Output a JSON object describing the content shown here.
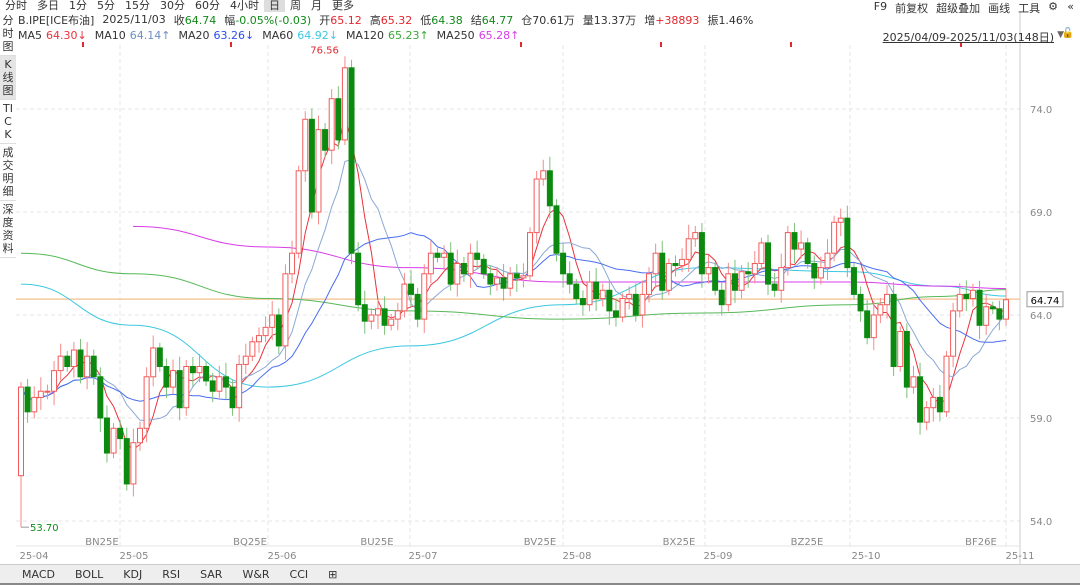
{
  "period_tabs": [
    "分时",
    "多日",
    "1分",
    "5分",
    "15分",
    "30分",
    "60分",
    "4小时",
    "日",
    "周",
    "月",
    "更多"
  ],
  "selected_period": "日",
  "right_tools": [
    "F9",
    "前复权",
    "超级叠加",
    "画线",
    "工具"
  ],
  "left_tabs": [
    "分时图",
    "K线图",
    "TICK",
    "成交明细",
    "深度资料"
  ],
  "info": {
    "symbol": "B.IPE[ICE布油]",
    "date": "2025/11/03",
    "close_label": "收",
    "close": "64.74",
    "change_label": "幅",
    "change": "-0.05%(-0.03)",
    "open_label": "开",
    "open": "65.12",
    "high_label": "高",
    "high": "65.32",
    "low_label": "低",
    "low": "64.38",
    "settle_label": "结",
    "settle": "64.77",
    "oi_label": "仓",
    "oi": "70.61万",
    "vol_label": "量",
    "vol": "13.37万",
    "inc_label": "增",
    "inc": "+38893",
    "amp_label": "振",
    "amp": "1.46%"
  },
  "ma": [
    {
      "name": "MA5",
      "value": "64.30↓",
      "color": "#e8323c"
    },
    {
      "name": "MA10",
      "value": "64.14↑",
      "color": "#6a8fc4"
    },
    {
      "name": "MA20",
      "value": "63.26↓",
      "color": "#2a4df0"
    },
    {
      "name": "MA60",
      "value": "64.92↓",
      "color": "#3cc8e0"
    },
    {
      "name": "MA120",
      "value": "65.23↑",
      "color": "#3aa63a"
    },
    {
      "name": "MA250",
      "value": "65.28↑",
      "color": "#d83ce8"
    }
  ],
  "date_range": "2025/04/09-2025/11/03(148日)",
  "bottom_tabs": [
    "MACD",
    "BOLL",
    "KDJ",
    "RSI",
    "SAR",
    "W&R",
    "CCI",
    "⊞"
  ],
  "chart_data": {
    "type": "candlestick",
    "y_ticks": [
      "74.0",
      "69.0",
      "64.0",
      "59.0",
      "54.0"
    ],
    "ylim": [
      53.0,
      77.0
    ],
    "month_labels": [
      "25-04",
      "25-05",
      "25-06",
      "25-07",
      "25-08",
      "25-09",
      "25-10",
      "25-11"
    ],
    "contract_labels": [
      "BN25E",
      "BQ25E",
      "BU25E",
      "BV25E",
      "BX25E",
      "BZ25E",
      "BF26E"
    ],
    "first_open": 56.2,
    "max_label": "76.56",
    "min_label": "53.70",
    "last_price": "64.74",
    "reference_price": 64.77,
    "closes": [
      60.5,
      59.3,
      60.0,
      60.3,
      60.3,
      61.3,
      62.0,
      61.5,
      62.3,
      61.0,
      62.0,
      61.0,
      59.0,
      57.3,
      58.5,
      58.0,
      55.8,
      57.8,
      58.5,
      61.0,
      62.4,
      61.5,
      60.5,
      61.3,
      59.5,
      61.5,
      61.2,
      61.5,
      60.8,
      60.3,
      61.0,
      60.5,
      59.5,
      61.6,
      62.0,
      62.7,
      63.0,
      63.4,
      64.0,
      62.5,
      66.0,
      67.0,
      71.0,
      73.5,
      69.0,
      73.0,
      72.0,
      74.5,
      72.5,
      76.0,
      67.0,
      64.5,
      63.7,
      64.0,
      64.3,
      63.5,
      63.8,
      64.2,
      65.5,
      65.0,
      63.8,
      66.0,
      67.0,
      66.8,
      67.0,
      65.5,
      66.5,
      66.0,
      67.0,
      66.7,
      66.0,
      65.5,
      65.8,
      65.3,
      66.0,
      65.8,
      65.9,
      68.0,
      70.6,
      71.0,
      69.3,
      67.0,
      66.0,
      65.5,
      64.8,
      64.5,
      65.6,
      64.8,
      65.2,
      64.2,
      63.9,
      64.8,
      65.0,
      64.0,
      65.0,
      66.0,
      67.0,
      65.2,
      66.5,
      66.4,
      66.7,
      67.7,
      68.0,
      66.0,
      66.3,
      65.2,
      64.5,
      66.0,
      65.2,
      66.1,
      66.0,
      66.5,
      67.5,
      65.5,
      65.2,
      66.3,
      68.0,
      67.2,
      67.5,
      66.5,
      65.8,
      66.3,
      67.0,
      68.5,
      68.7,
      66.3,
      65.0,
      64.2,
      62.9,
      64.0,
      64.5,
      65.0,
      61.5,
      63.2,
      60.5,
      61.0,
      58.8,
      59.5,
      60.0,
      59.3,
      62.0,
      64.2,
      65.0,
      64.8,
      65.2,
      63.5,
      64.4,
      64.3,
      63.8,
      64.74
    ],
    "long_ma": {
      "MA60": [
        65.5,
        63.5,
        60.5,
        62.5,
        64.5,
        66.3,
        66.1,
        65.4,
        64.92
      ],
      "MA120": [
        67.0,
        66.0,
        64.8,
        64.2,
        63.8,
        64.1,
        64.5,
        64.9,
        65.23
      ],
      "MA250": [
        null,
        68.3,
        67.3,
        66.3,
        65.6,
        65.6,
        65.6,
        65.4,
        65.28
      ]
    }
  }
}
